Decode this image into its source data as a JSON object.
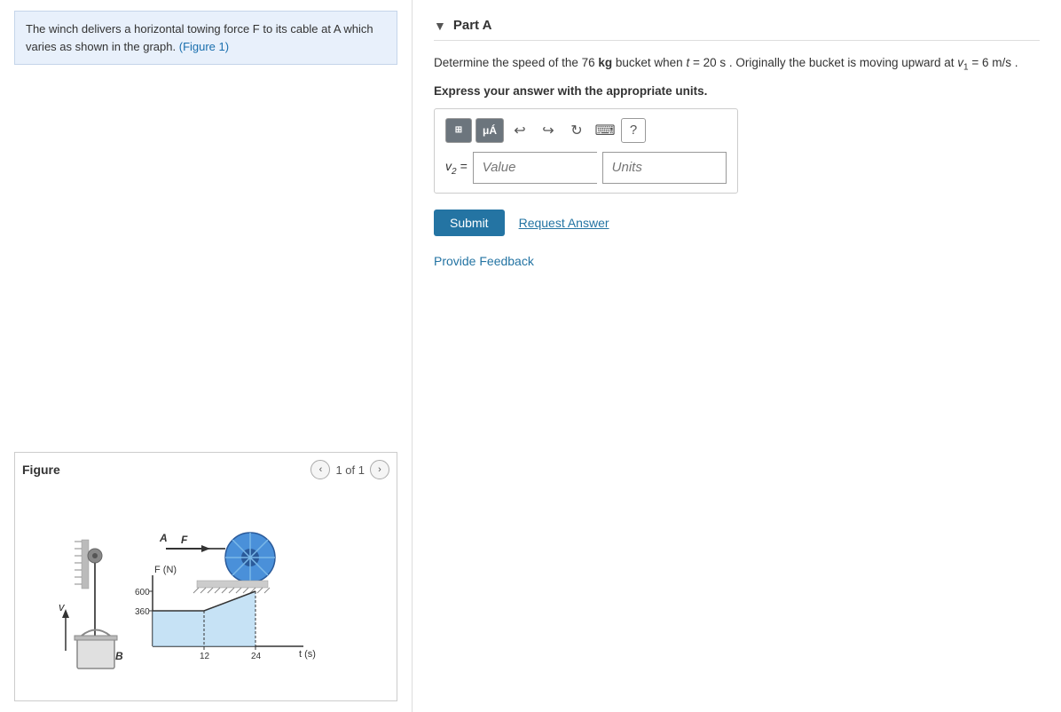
{
  "left_panel": {
    "problem_text": "The winch delivers a horizontal towing force F to its cable at A which varies as shown in the graph.",
    "figure_link_text": "(Figure 1)",
    "figure": {
      "title": "Figure",
      "page_indicator": "1 of 1",
      "nav_prev": "‹",
      "nav_next": "›"
    }
  },
  "right_panel": {
    "part_toggle": "▼",
    "part_title": "Part A",
    "description_line1": "Determine the speed of the 76 kg bucket when t = 20 s . Originally the bucket is moving upward at v",
    "description_line1_sub": "1",
    "description_line1_suffix": " = 6 m/s .",
    "express_label": "Express your answer with the appropriate units.",
    "toolbar": {
      "split_icon": "⊞",
      "mu_icon": "μÁ",
      "undo_icon": "↩",
      "redo_icon": "↪",
      "refresh_icon": "↻",
      "keyboard_icon": "⌨",
      "help_icon": "?"
    },
    "answer": {
      "label": "v₂ =",
      "value_placeholder": "Value",
      "units_placeholder": "Units"
    },
    "submit_label": "Submit",
    "request_answer_label": "Request Answer",
    "provide_feedback_label": "Provide Feedback"
  },
  "diagram": {
    "f_axis_label": "F (N)",
    "t_axis_label": "t (s)",
    "y_values": [
      "600",
      "360"
    ],
    "x_values": [
      "12",
      "24"
    ],
    "labels": {
      "A": "A",
      "F": "F",
      "B": "B",
      "v": "v"
    }
  }
}
